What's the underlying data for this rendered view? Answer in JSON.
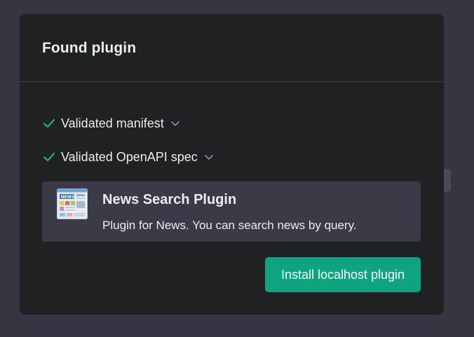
{
  "modal": {
    "title": "Found plugin",
    "checks": [
      {
        "label": "Validated manifest",
        "icon": "check-icon",
        "expand_icon": "chevron-down-icon"
      },
      {
        "label": "Validated OpenAPI spec",
        "icon": "check-icon",
        "expand_icon": "chevron-down-icon"
      }
    ],
    "plugin": {
      "name": "News Search Plugin",
      "description": "Plugin for News. You can search news by query.",
      "logo": "newspaper-logo",
      "logo_text": "NEWS"
    },
    "install_label": "Install localhost plugin"
  },
  "colors": {
    "backdrop": "#363642",
    "modal_bg": "#202123",
    "card_bg": "#3b3b48",
    "accent": "#10a37f",
    "check": "#19c37d",
    "text": "#ececf1"
  }
}
